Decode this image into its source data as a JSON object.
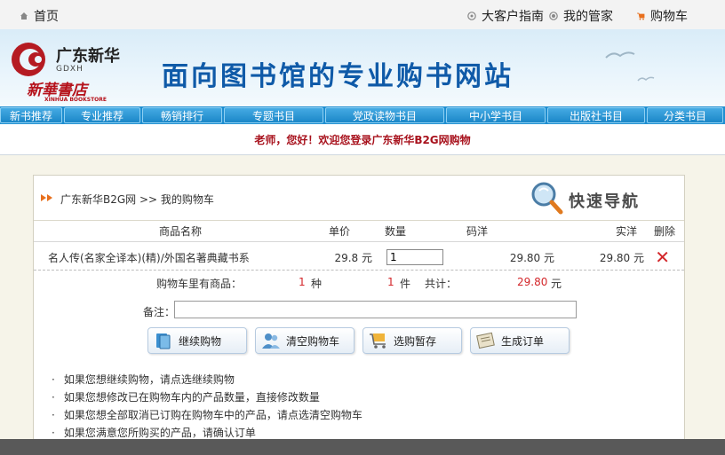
{
  "topbar": {
    "home_label": "首页",
    "vip_guide_label": "大客户指南",
    "my_steward_label": "我的管家",
    "cart_label": "购物车"
  },
  "header": {
    "logo_name": "广东新华",
    "logo_sub": "GDXH",
    "logo_script": "新華書店",
    "logo_en": "XINHUA BOOKSTORE",
    "slogan": "面向图书馆的专业购书网站"
  },
  "nav": {
    "items": [
      {
        "label": "新书推荐"
      },
      {
        "label": "专业推荐"
      },
      {
        "label": "畅销排行"
      },
      {
        "label": "专题书目"
      },
      {
        "label": "党政读物书目"
      },
      {
        "label": "中小学书目"
      },
      {
        "label": "出版社书目"
      },
      {
        "label": "分类书目"
      }
    ]
  },
  "welcome": "老师，您好！欢迎您登录广东新华B2G网购物",
  "cart": {
    "breadcrumb": "广东新华B2G网 >> 我的购物车",
    "quick_nav_label": "快速导航",
    "columns": {
      "name": "商品名称",
      "unit_price": "单价",
      "quantity": "数量",
      "list_price": "码洋",
      "actual_price": "实洋",
      "delete": "删除"
    },
    "rows": [
      {
        "name": "名人传(名家全译本)(精)/外国名著典藏书系",
        "unit_price": "29.8 元",
        "quantity": "1",
        "list_price": "29.80 元",
        "actual_price": "29.80 元"
      }
    ],
    "summary": {
      "label": "购物车里有商品：",
      "kinds_count": "1",
      "kinds_unit": "种",
      "items_count": "1",
      "items_unit": "件",
      "total_label": "共计：",
      "total_value": "29.80",
      "total_unit": "元"
    },
    "note_label": "备注：",
    "note_value": "",
    "buttons": {
      "continue": "继续购物",
      "clear": "清空购物车",
      "save": "选购暂存",
      "order": "生成订单"
    },
    "tips": [
      "如果您想继续购物，请点选继续购物",
      "如果您想修改已在购物车内的产品数量，直接修改数量",
      "如果您想全部取消已订购在购物车中的产品，请点选清空购物车",
      "如果您满意您所购买的产品，请确认订单"
    ]
  },
  "colors": {
    "nav_blue": "#1f8ed0",
    "slogan_blue": "#0f5aa8",
    "welcome_red": "#a8121d",
    "accent_red": "#d3262a",
    "main_bg": "#f6f4e9"
  }
}
